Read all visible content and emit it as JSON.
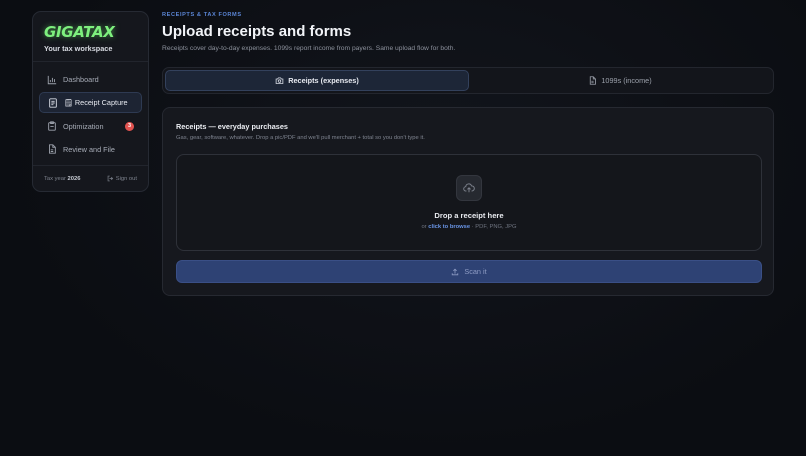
{
  "sidebar": {
    "logo": "GIGATAX",
    "tagline": "Your tax workspace",
    "items": [
      {
        "label": "Dashboard",
        "icon": "bar-chart-icon"
      },
      {
        "label": "Receipt Capture",
        "icon": "receipt-icon",
        "prefix": "🗒"
      },
      {
        "label": "Optimization",
        "icon": "clipboard-icon",
        "badge": "3"
      },
      {
        "label": "Review and File",
        "icon": "document-icon"
      }
    ],
    "footer": {
      "tax_year_label": "Tax year",
      "tax_year_value": "2026",
      "signout": "Sign out"
    }
  },
  "header": {
    "eyebrow": "RECEIPTS & TAX FORMS",
    "title": "Upload receipts and forms",
    "subtitle": "Receipts cover day-to-day expenses. 1099s report income from payers. Same upload flow for both."
  },
  "tabs": [
    {
      "label": "Receipts (expenses)",
      "icon": "camera-icon",
      "active": true
    },
    {
      "label": "1099s (income)",
      "icon": "document-icon",
      "active": false
    }
  ],
  "upload_card": {
    "title": "Receipts — everyday purchases",
    "description": "Gas, gear, software, whatever. Drop a pic/PDF and we'll pull merchant + total so you don't type it.",
    "dropzone": {
      "title": "Drop a receipt here",
      "prefix": "or",
      "browse": "click to browse",
      "formats": "· PDF, PNG, JPG"
    },
    "scan_button": "Scan it"
  },
  "colors": {
    "accent": "#5b86d6",
    "brand": "#7ef07e",
    "badge": "#e0524f"
  }
}
